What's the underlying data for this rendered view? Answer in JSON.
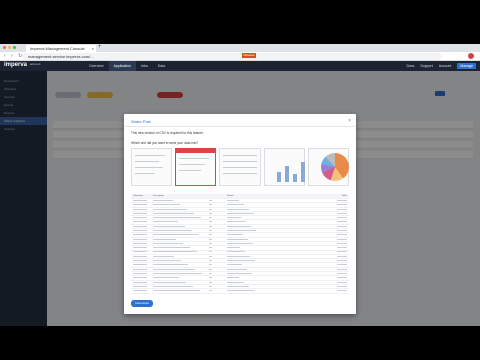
{
  "browser": {
    "tab_title": "Imperva Management Console",
    "url": "management.service.imperva.com/..."
  },
  "header": {
    "logo": "imperva",
    "account": "account",
    "nav": [
      "Overview",
      "Application",
      "Infra",
      "Data"
    ],
    "badge": "Release",
    "right": [
      "Docs",
      "Support",
      "Account",
      "Manage"
    ]
  },
  "sidebar": {
    "items": [
      "Dashboard",
      "Websites",
      "Security",
      "Events",
      "Reports",
      "Attack Analytics",
      "Settings"
    ],
    "active_index": 5
  },
  "modal": {
    "title": "Share Post",
    "text1": "This new version of CSV is required for this feature.",
    "text2": "Which one did you want to send your data into?",
    "table_headers": [
      "Parameter",
      "Description",
      "",
      "Details",
      "Value"
    ],
    "download_label": "Download"
  },
  "colors": {
    "accent": "#2f6fd0",
    "header": "#1c2433",
    "badge": "#e04b1c"
  }
}
